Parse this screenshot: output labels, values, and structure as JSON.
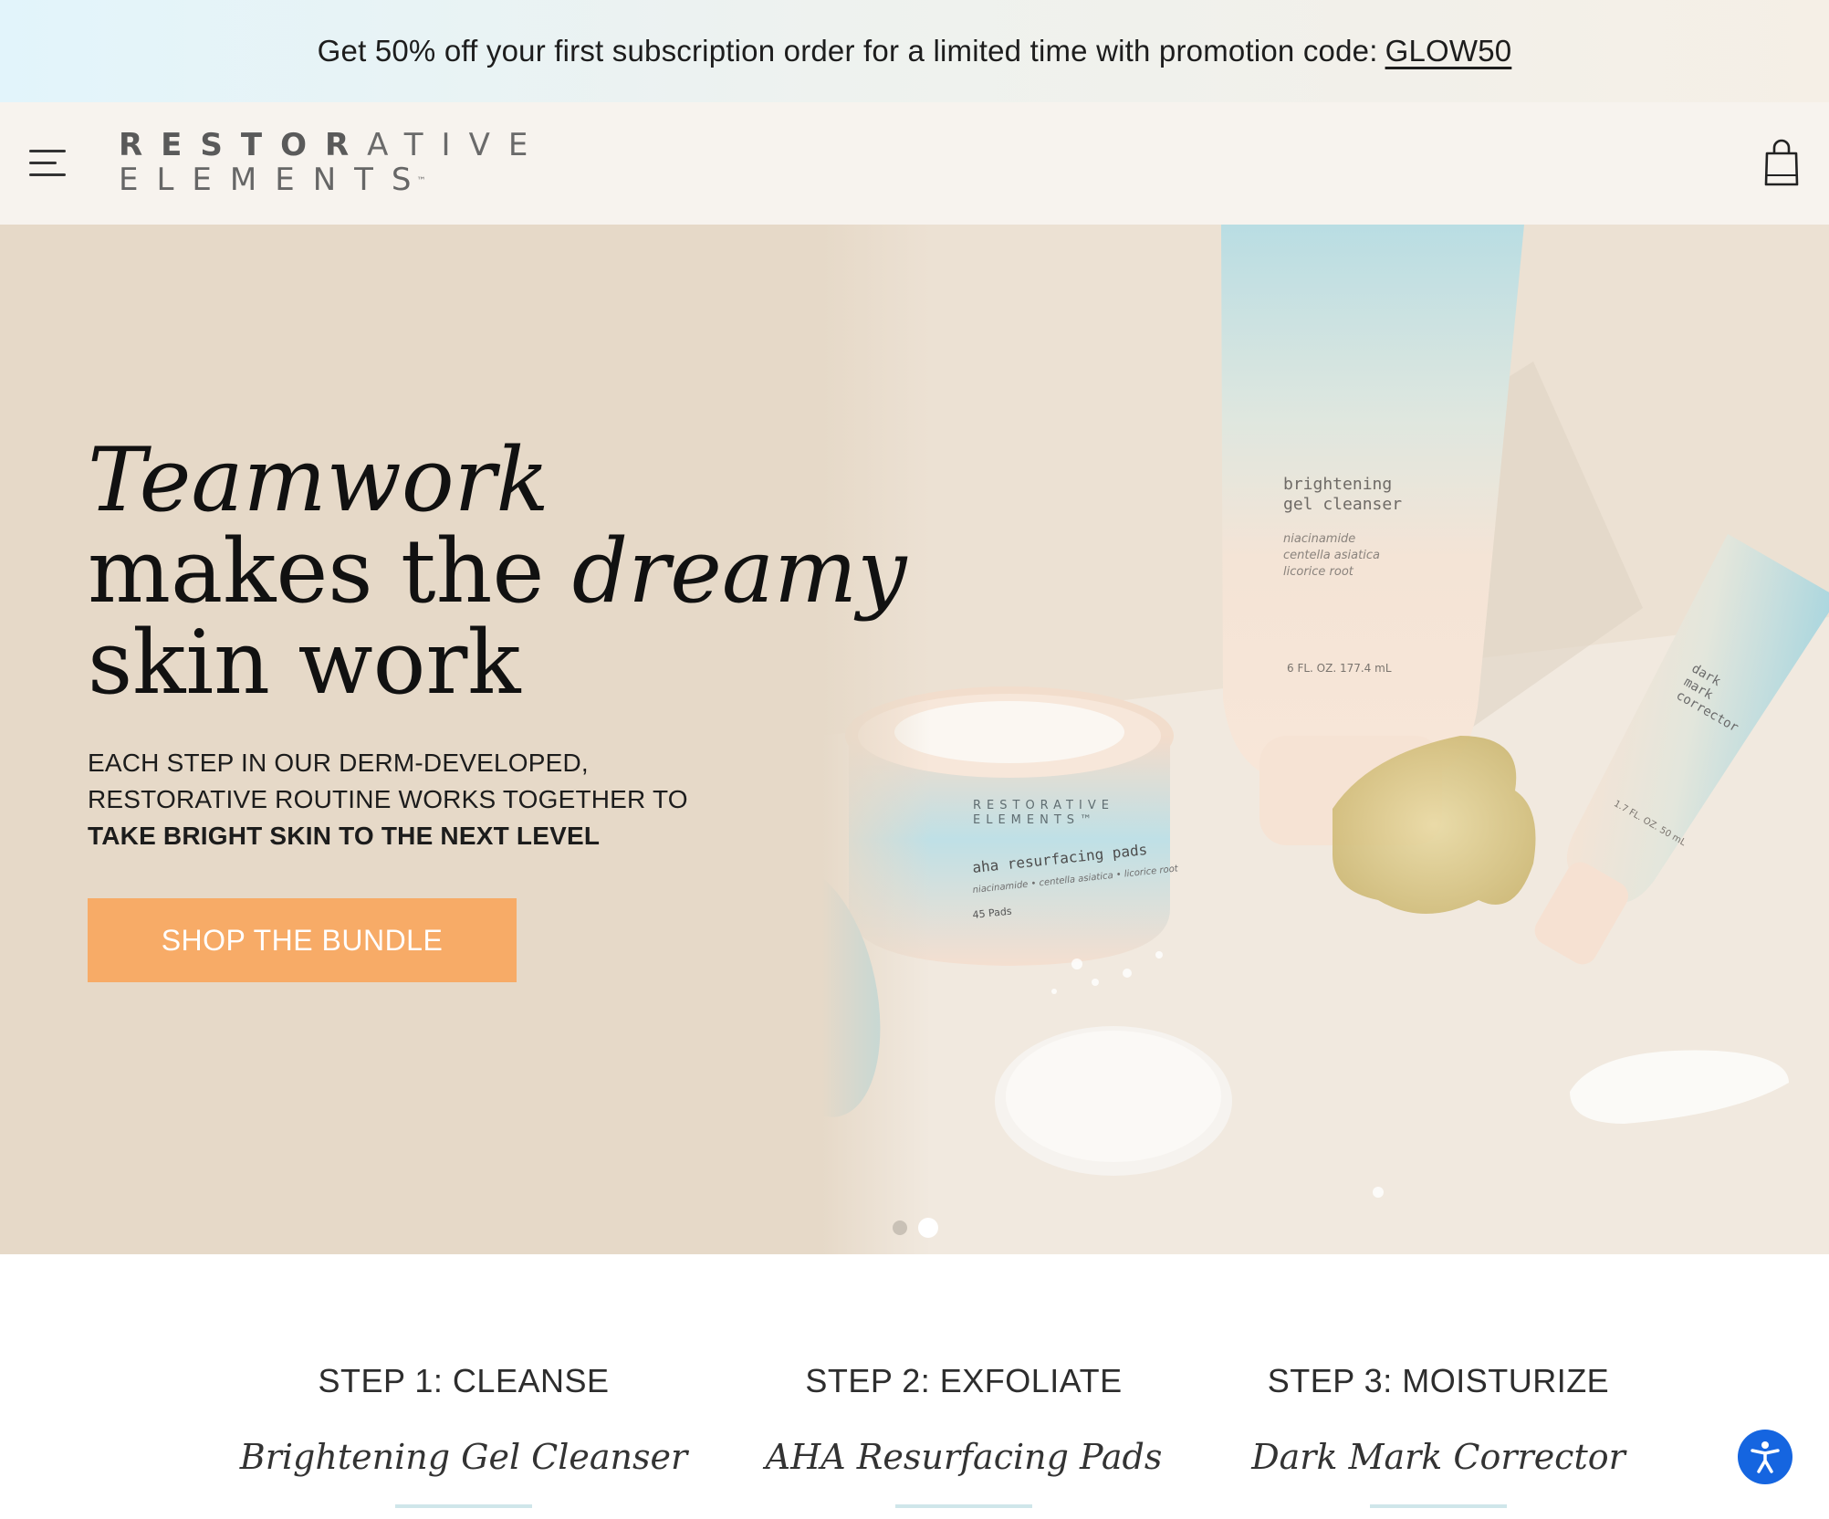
{
  "promo": {
    "text": "Get 50% off your first subscription order for a limited time with promotion code:",
    "code": "GLOW50"
  },
  "header": {
    "menu_icon": "hamburger-menu-icon",
    "logo": {
      "line1_bold": "RESTOR",
      "line1_light": "ATIVE",
      "line2": "ELEMENTS",
      "tm": "™"
    },
    "cart_icon": "shopping-bag-icon"
  },
  "hero": {
    "headline": {
      "line1": "Teamwork",
      "line2_start": "makes the ",
      "line2_em": "dreamy",
      "line3": "skin work"
    },
    "subcopy": {
      "line1": "EACH STEP IN OUR DERM-DEVELOPED,",
      "line2": "RESTORATIVE ROUTINE WORKS TOGETHER TO",
      "line3": "TAKE BRIGHT SKIN TO THE NEXT LEVEL"
    },
    "cta_label": "SHOP THE BUNDLE",
    "products": {
      "cleanser_name": "brightening gel cleanser",
      "cleanser_ingredients": "niacinamide centella asiatica licorice root",
      "cleanser_size": "6 FL. OZ. 177.4 mL",
      "pads_brand": "RESTORATIVE ELEMENTS",
      "pads_name": "aha resurfacing pads",
      "pads_ingredients": "niacinamide • centella asiatica • licorice root",
      "pads_count": "45 Pads",
      "corrector_name": "dark mark corrector",
      "corrector_size": "1.7 FL. OZ. 50 mL"
    },
    "slides": {
      "count": 2,
      "active": 2
    }
  },
  "steps": [
    {
      "label": "STEP 1: CLEANSE",
      "product": "Brightening Gel Cleanser"
    },
    {
      "label": "STEP 2: EXFOLIATE",
      "product": "AHA Resurfacing Pads"
    },
    {
      "label": "STEP 3: MOISTURIZE",
      "product": "Dark Mark Corrector"
    }
  ],
  "accessibility_icon": "accessibility-icon",
  "colors": {
    "cta": "#f7ab67",
    "hero_bg": "#e6d9c8",
    "header_bg": "#f7f3ee",
    "accessibility": "#1565e0"
  }
}
